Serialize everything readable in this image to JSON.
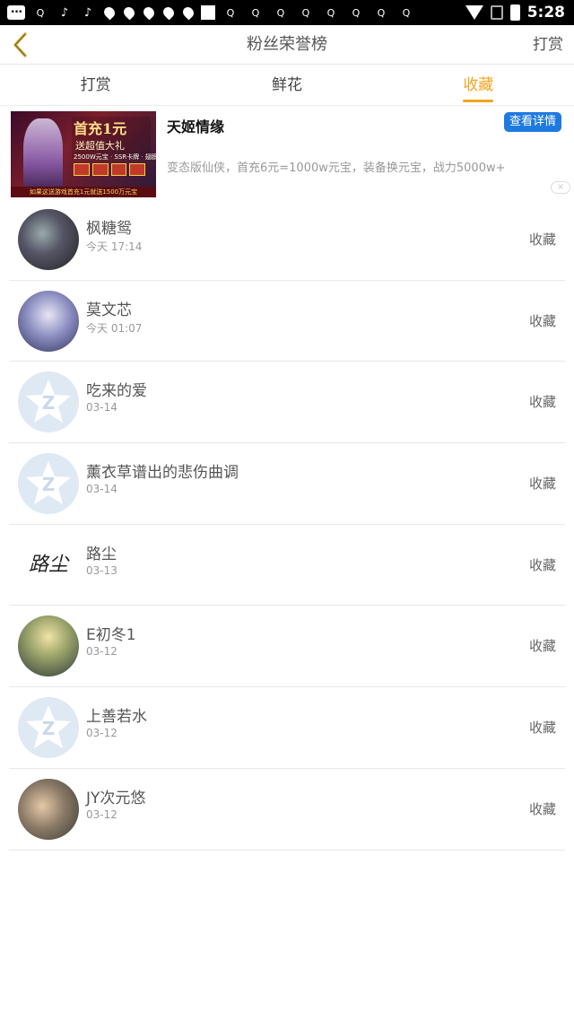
{
  "status_bar": {
    "q_label": "Q",
    "time": "5:28"
  },
  "nav": {
    "title": "粉丝荣誉榜",
    "right_action": "打赏"
  },
  "tabs": [
    {
      "label": "打赏",
      "active": false
    },
    {
      "label": "鲜花",
      "active": false
    },
    {
      "label": "收藏",
      "active": true
    }
  ],
  "ad": {
    "image_text": {
      "headline": "首充1元",
      "subline": "送超值大礼",
      "small": "2500W元宝 · SSR卡牌 · 翅膀",
      "footer": "如果这送游戏首充1元就送1500万元宝"
    },
    "title": "天姬情缘",
    "button": "查看详情",
    "description": "变态版仙侠，首充6元=1000w元宝，装备换元宝，战力5000w+",
    "close": "×"
  },
  "list": [
    {
      "name": "枫糖鸳",
      "time": "今天 17:14",
      "action": "收藏",
      "avatar": "photo"
    },
    {
      "name": "莫文芯",
      "time": "今天 01:07",
      "action": "收藏",
      "avatar": "photo"
    },
    {
      "name": "吃来的爱",
      "time": "03-14",
      "action": "收藏",
      "avatar": "default"
    },
    {
      "name": "薰衣草谱出的悲伤曲调",
      "time": "03-14",
      "action": "收藏",
      "avatar": "default"
    },
    {
      "name": "路尘",
      "time": "03-13",
      "action": "收藏",
      "avatar": "photo",
      "avatar_text": "路尘"
    },
    {
      "name": "E初冬1",
      "time": "03-12",
      "action": "收藏",
      "avatar": "photo"
    },
    {
      "name": "上善若水",
      "time": "03-12",
      "action": "收藏",
      "avatar": "default"
    },
    {
      "name": "JY次元悠",
      "time": "03-12",
      "action": "收藏",
      "avatar": "photo"
    }
  ],
  "colors": {
    "accent": "#f0a51e",
    "ad_button": "#1f7ae0",
    "default_avatar_bg": "#dfe9f4"
  }
}
